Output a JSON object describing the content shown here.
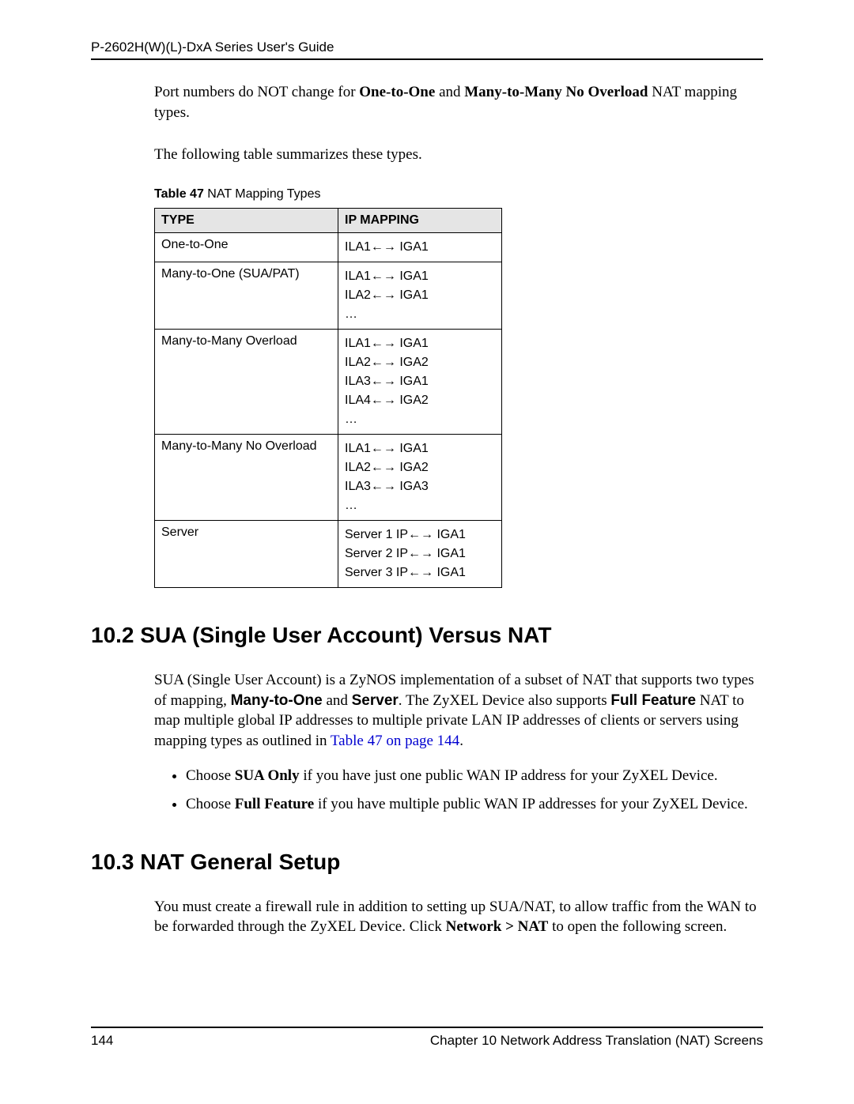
{
  "header": {
    "title": "P-2602H(W)(L)-DxA Series User's Guide"
  },
  "intro": {
    "p1_a": "Port numbers do NOT change for ",
    "p1_b": "One-to-One",
    "p1_c": " and ",
    "p1_d": "Many-to-Many No Overload",
    "p1_e": " NAT mapping types.",
    "p2": "The following table summarizes these types."
  },
  "table": {
    "caption_bold": "Table 47",
    "caption_rest": "   NAT Mapping Types",
    "head_type": "TYPE",
    "head_map": "IP MAPPING",
    "rows": [
      {
        "type": "One-to-One",
        "map": [
          "ILA1←→ IGA1"
        ]
      },
      {
        "type": "Many-to-One (SUA/PAT)",
        "map": [
          "ILA1←→ IGA1",
          "ILA2←→ IGA1",
          "…"
        ]
      },
      {
        "type": "Many-to-Many Overload",
        "map": [
          "ILA1←→ IGA1",
          "ILA2←→ IGA2",
          "ILA3←→ IGA1",
          "ILA4←→ IGA2",
          "…"
        ]
      },
      {
        "type": "Many-to-Many No Overload",
        "map": [
          "ILA1←→ IGA1",
          "ILA2←→ IGA2",
          "ILA3←→ IGA3",
          "…"
        ]
      },
      {
        "type": "Server",
        "map": [
          "Server 1 IP←→ IGA1",
          "Server 2 IP←→ IGA1",
          "Server 3 IP←→ IGA1"
        ]
      }
    ]
  },
  "s102": {
    "heading": "10.2  SUA (Single User Account) Versus NAT",
    "p_a": "SUA (Single User Account) is a ZyNOS implementation of a subset of NAT that supports two types of mapping, ",
    "p_b": "Many-to-One",
    "p_c": " and ",
    "p_d": "Server",
    "p_e": ". The ZyXEL Device also supports ",
    "p_f": "Full Feature",
    "p_g": " NAT to map multiple global IP addresses to multiple private LAN IP addresses of clients or servers using mapping types as outlined in ",
    "p_link": "Table 47 on page 144",
    "p_end": ".",
    "b1_a": "Choose ",
    "b1_b": "SUA Only",
    "b1_c": " if you have just one public WAN IP address for your ZyXEL Device.",
    "b2_a": "Choose ",
    "b2_b": "Full Feature",
    "b2_c": " if you have multiple public WAN IP addresses for your ZyXEL Device."
  },
  "s103": {
    "heading": "10.3  NAT General Setup",
    "p_a": "You must create a firewall rule in addition to setting up SUA/NAT, to allow traffic from the WAN to be forwarded through the ZyXEL Device. Click ",
    "p_b": "Network > NAT",
    "p_c": " to open the following screen."
  },
  "footer": {
    "page": "144",
    "chapter": "Chapter 10 Network Address Translation (NAT) Screens"
  }
}
